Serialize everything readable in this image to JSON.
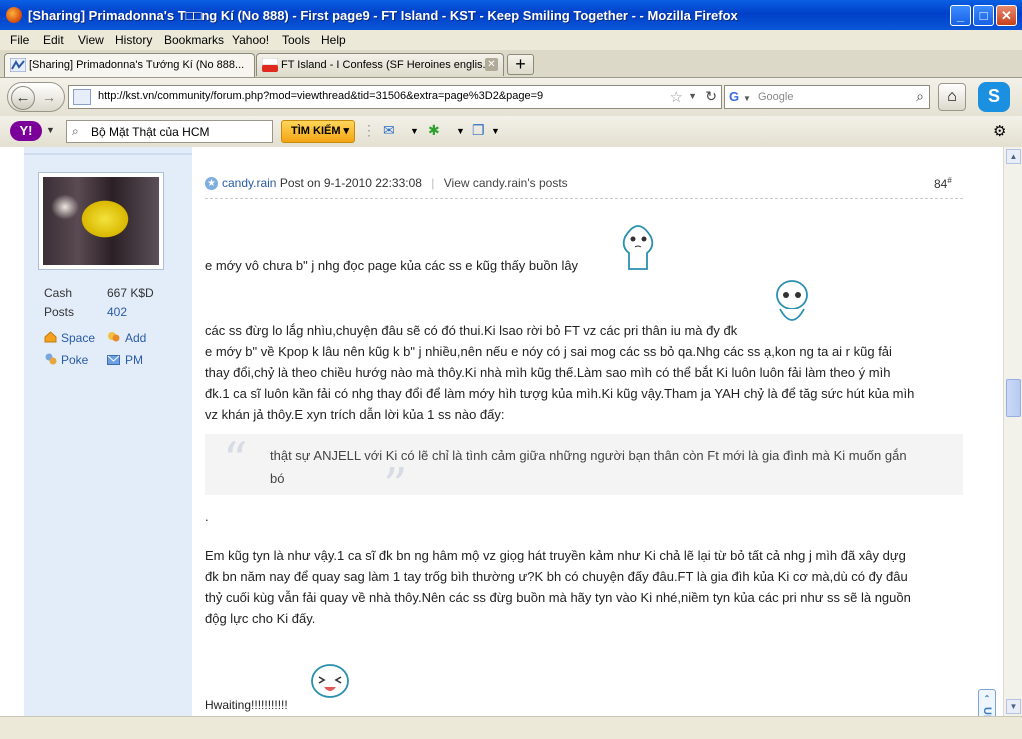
{
  "window": {
    "title": "[Sharing] Primadonna's T□□ng Kí (No 888) - First page9 - FT Island - KST - Keep Smiling Together - - Mozilla Firefox"
  },
  "menu": [
    "File",
    "Edit",
    "View",
    "History",
    "Bookmarks",
    "Yahoo!",
    "Tools",
    "Help"
  ],
  "tabs": [
    {
      "label": "[Sharing] Primadonna's Tướng Kí (No 888...",
      "icon": "kst-favicon"
    },
    {
      "label": "FT Island - I Confess (SF Heroines englis...",
      "icon": "youtube-favicon",
      "icon_text": "You Tube"
    }
  ],
  "nav": {
    "url": "http://kst.vn/community/forum.php?mod=viewthread&tid=31506&extra=page%3D2&page=9",
    "search_engine": "G",
    "search_placeholder": "Google"
  },
  "yahoo": {
    "logo": "Y!",
    "search_value": "Bộ Mặt Thật của HCM",
    "search_button": "TÌM KIẾM ▾"
  },
  "profile": {
    "cash_label": "Cash",
    "cash_value": "667 K$D",
    "posts_label": "Posts",
    "posts_value": "402",
    "space": "Space",
    "add": "Add",
    "poke": "Poke",
    "pm": "PM"
  },
  "post": {
    "author": "candy.rain",
    "posted": "Post on 9-1-2010 22:33:08",
    "view_posts": "View candy.rain's posts",
    "number": "84",
    "number_sup": "#",
    "line1": "e mớy vô chưa b\" j nhg đọc page kủa các ss e kũg thấy buồn lây",
    "para2": [
      "các ss đừg lo lắg nhìu,chuyện đâu sẽ có đó thui.Ki lsao rời bỏ FT vz các pri thân iu mà đy đk",
      "e mớy b\" về Kpop k lâu nên kũg k b\" j nhiều,nên nếu e nóy có j sai mog các ss bỏ qa.Nhg các ss ạ,kon ng ta ai r kũg fải",
      "thay đổi,chỷ là theo chiều hướg nào mà thôy.Ki nhà mìh kũg thế.Làm sao mìh có thể bắt Ki luôn luôn fải làm theo ý mìh",
      "đk.1 ca sĩ luôn kần fải có nhg thay đổi để làm mớy hìh tượg kủa mìh.Ki kũg vậy.Tham ja YAH chỷ là để tăg sức hút kủa mìh",
      "vz  khán jả thôy.E xyn trích dẫn lời kủa 1 ss nào đấy:"
    ],
    "quote": "thật sự ANJELL với Ki có lẽ chỉ là tình cảm giữa những người bạn thân còn Ft mới là gia đình mà Ki muốn gắn bó",
    "dot": ".",
    "para3": [
      "Em kũg tyn là như vậy.1 ca sĩ đk bn ng hâm mộ vz giọg hát truyền kảm như Ki chả lẽ lại từ bỏ tất cả nhg j mìh đã xây dựg",
      "đk bn năm nay để quay sag làm 1 tay trốg bìh thường ư?K bh có chuyện đấy đâu.FT là gia đìh kủa Ki cơ mà,dù có đy đâu",
      "thỷ cuối kùg vẫn fải quay về nhà thôy.Nên các ss đừg buồn mà hãy tyn vào Ki nhé,niềm tyn kủa các pri như ss sẽ là nguồn",
      "độg lực cho Ki đấy."
    ],
    "closing": "Hwaiting!!!!!!!!!!!"
  },
  "up_button": "UP",
  "colors": {
    "link": "#2a5aa8",
    "sidebar_bg": "#e3edf9",
    "titlebar": "#0a5fe3"
  }
}
